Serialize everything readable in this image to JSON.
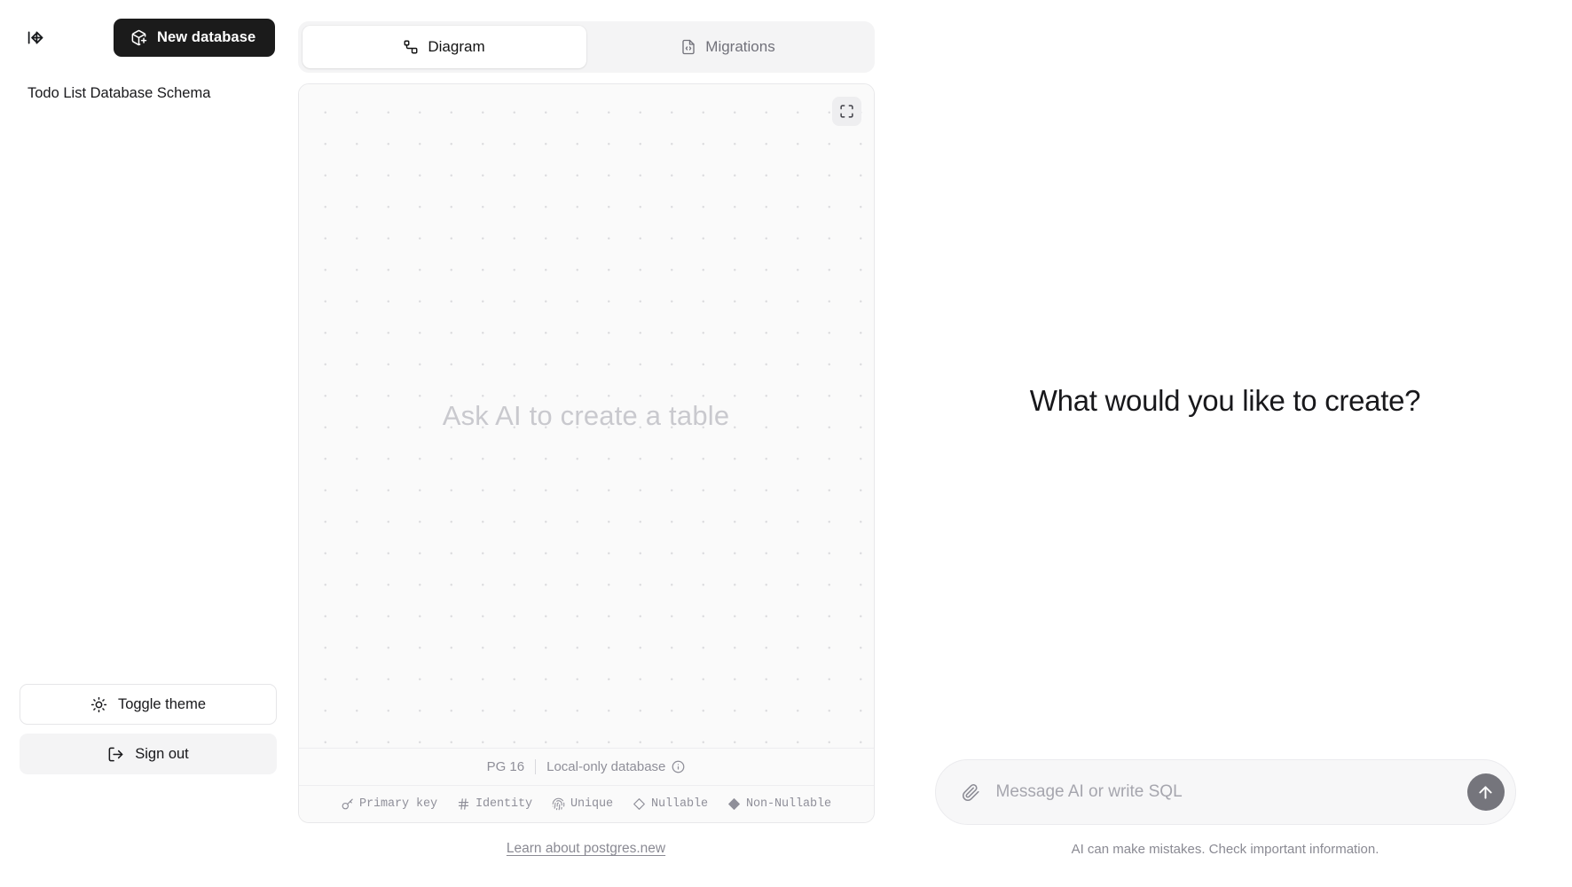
{
  "sidebar": {
    "collapse_icon": "arrow-left-to-line-icon",
    "new_database": {
      "label": "New database",
      "icon": "package-plus-icon"
    },
    "databases": [
      {
        "label": "Todo List Database Schema"
      }
    ],
    "toggle_theme": {
      "label": "Toggle theme",
      "icon": "sun-icon"
    },
    "sign_out": {
      "label": "Sign out",
      "icon": "log-out-icon"
    }
  },
  "tabs": [
    {
      "label": "Diagram",
      "icon": "workflow-icon",
      "active": true
    },
    {
      "label": "Migrations",
      "icon": "file-code-icon",
      "active": false
    }
  ],
  "canvas": {
    "placeholder": "Ask AI to create a table",
    "fullscreen_icon": "maximize-icon"
  },
  "status": {
    "pg_version": "PG 16",
    "local_label": "Local-only database",
    "info_icon": "info-circle-icon"
  },
  "legend": [
    {
      "label": "Primary key",
      "icon": "key-icon"
    },
    {
      "label": "Identity",
      "icon": "hash-icon"
    },
    {
      "label": "Unique",
      "icon": "fingerprint-icon"
    },
    {
      "label": "Nullable",
      "icon": "diamond-outline-icon"
    },
    {
      "label": "Non-Nullable",
      "icon": "diamond-filled-icon"
    }
  ],
  "learn_link": "Learn about postgres.new",
  "chat": {
    "heading": "What would you like to create?",
    "composer": {
      "attach_icon": "paperclip-icon",
      "placeholder": "Message AI or write SQL",
      "value": "",
      "send_icon": "arrow-up-icon"
    },
    "disclaimer": "AI can make mistakes. Check important information."
  },
  "colors": {
    "accent_dark": "#1b1b1b",
    "canvas_bg": "#fafafa",
    "muted_text": "#8f8f99",
    "send_button": "#75757c"
  }
}
